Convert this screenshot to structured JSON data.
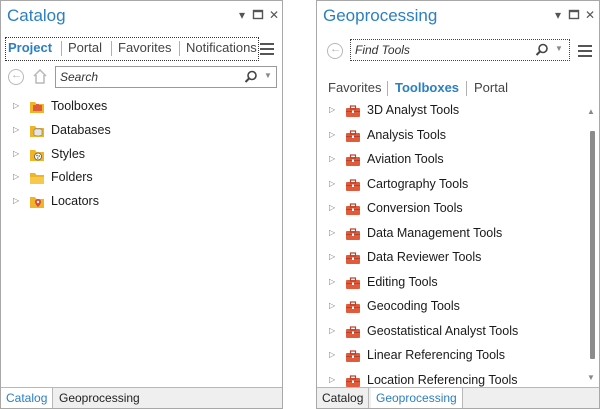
{
  "catalog": {
    "title": "Catalog",
    "tabs": [
      "Project",
      "Portal",
      "Favorites",
      "Notifications"
    ],
    "active_tab": "Project",
    "search_placeholder": "Search",
    "items": [
      {
        "label": "Toolboxes",
        "icon": "toolbox-folder-icon"
      },
      {
        "label": "Databases",
        "icon": "database-folder-icon"
      },
      {
        "label": "Styles",
        "icon": "styles-folder-icon"
      },
      {
        "label": "Folders",
        "icon": "folder-icon"
      },
      {
        "label": "Locators",
        "icon": "locator-folder-icon"
      }
    ],
    "bottom_tabs": [
      "Catalog",
      "Geoprocessing"
    ],
    "bottom_active": "Catalog"
  },
  "geoprocessing": {
    "title": "Geoprocessing",
    "search_placeholder": "Find Tools",
    "tabs": [
      "Favorites",
      "Toolboxes",
      "Portal"
    ],
    "active_tab": "Toolboxes",
    "items": [
      "3D Analyst Tools",
      "Analysis Tools",
      "Aviation Tools",
      "Cartography Tools",
      "Conversion Tools",
      "Data Management Tools",
      "Data Reviewer Tools",
      "Editing Tools",
      "Geocoding Tools",
      "Geostatistical Analyst Tools",
      "Linear Referencing Tools",
      "Location Referencing Tools"
    ],
    "bottom_tabs": [
      "Catalog",
      "Geoprocessing"
    ],
    "bottom_active": "Geoprocessing"
  },
  "colors": {
    "accent": "#2b7fc3",
    "toolbox_red": "#e05a3c",
    "folder_yellow": "#f0b429"
  }
}
